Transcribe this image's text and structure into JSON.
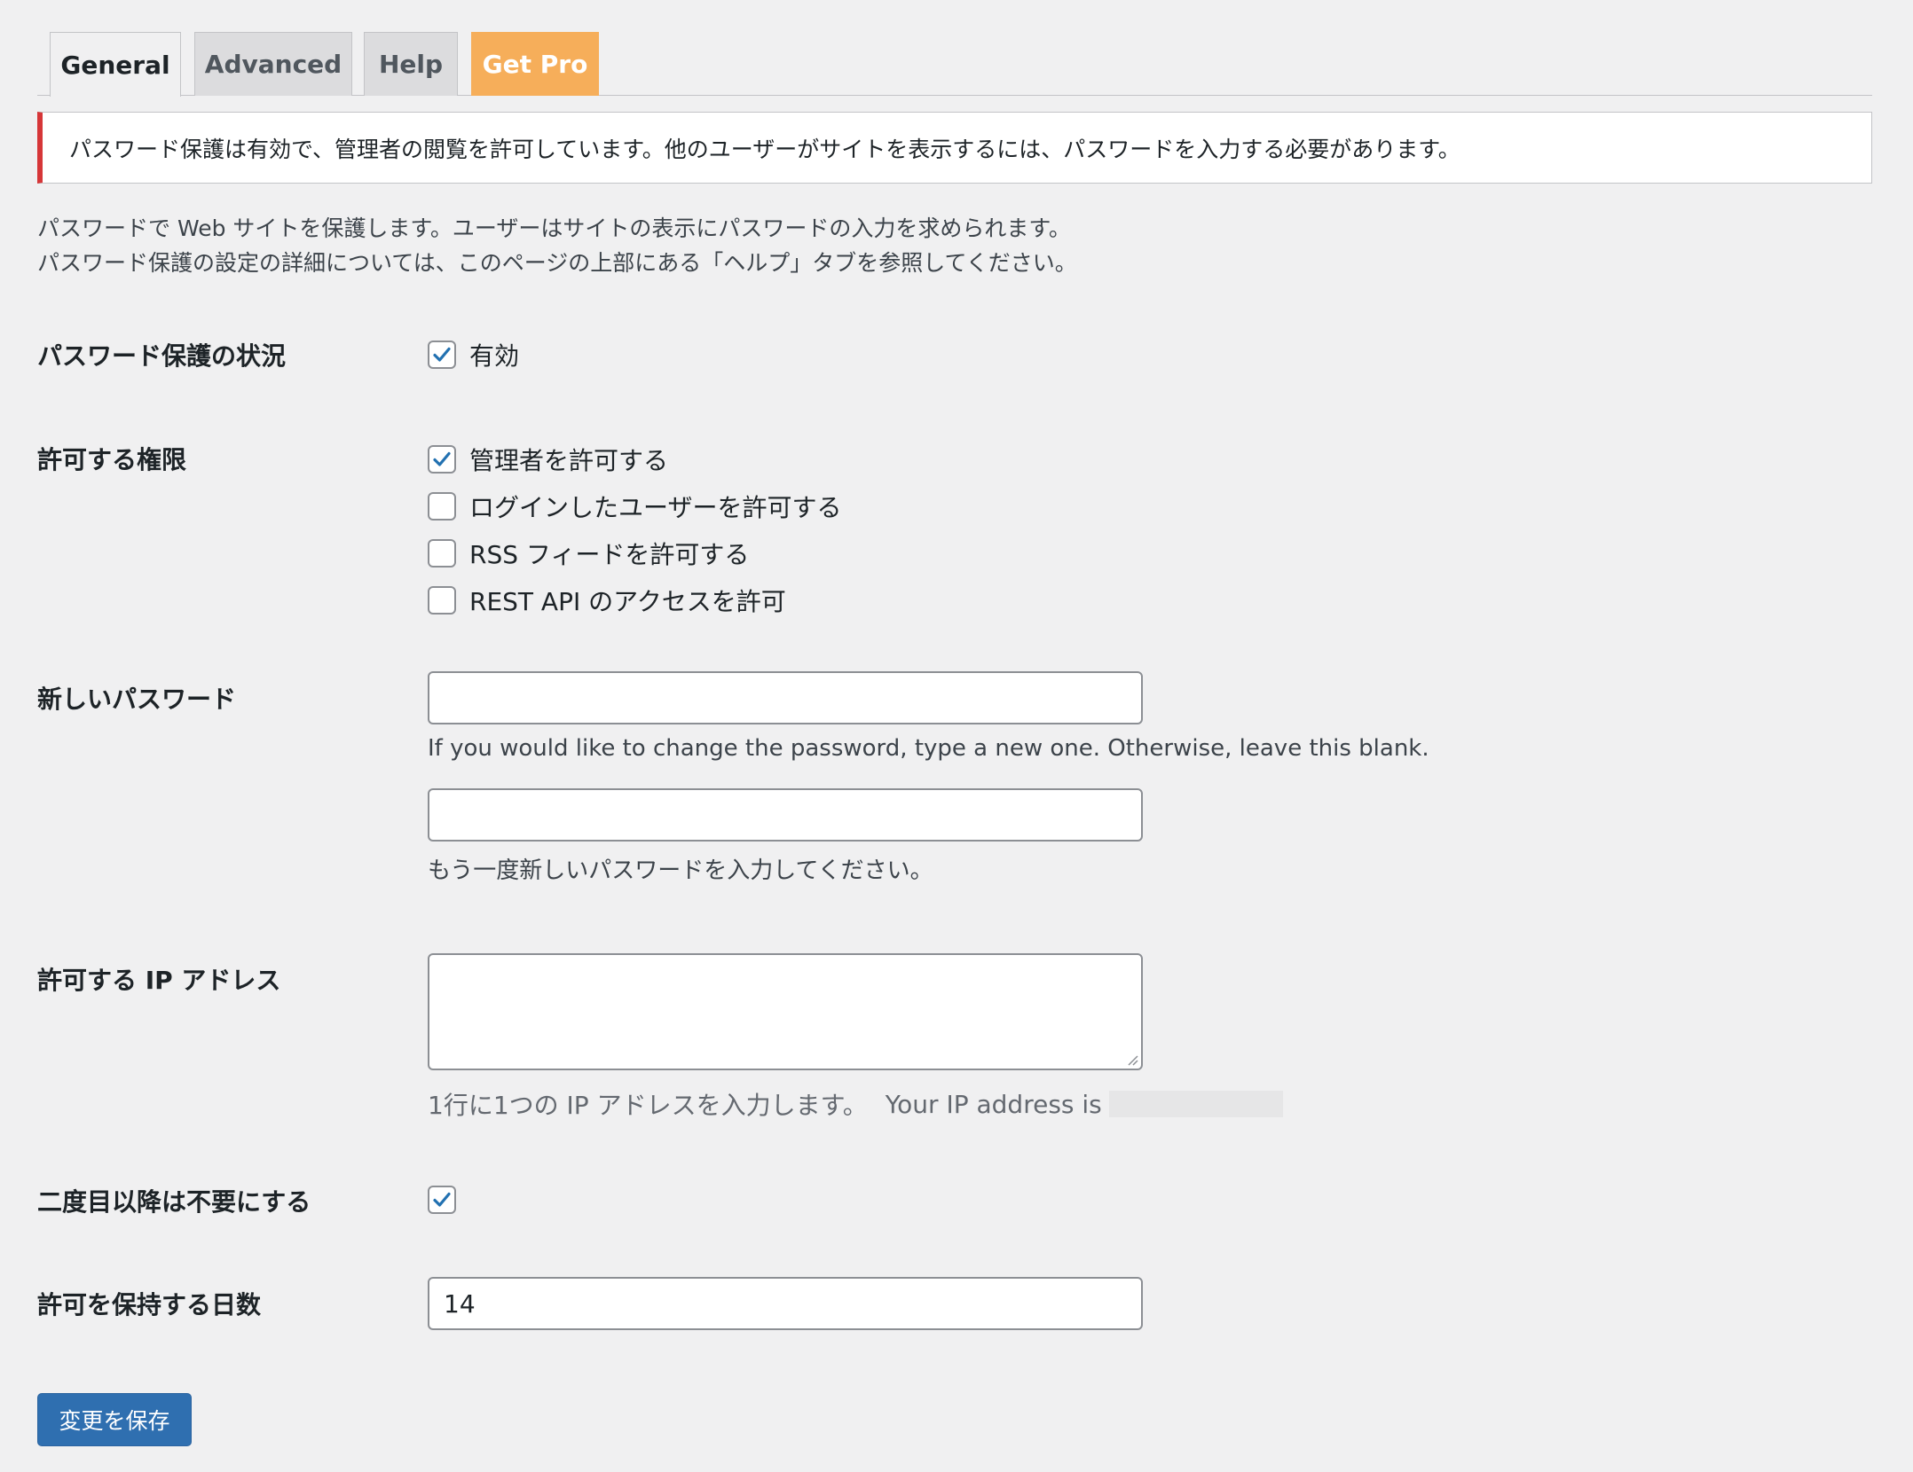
{
  "tabs": [
    {
      "label": "General",
      "active": true
    },
    {
      "label": "Advanced",
      "active": false
    },
    {
      "label": "Help",
      "active": false
    },
    {
      "label": "Get Pro",
      "active": false
    }
  ],
  "notice": {
    "text": "パスワード保護は有効で、管理者の閲覧を許可しています。他のユーザーがサイトを表示するには、パスワードを入力する必要があります。",
    "accent_color": "#d63638"
  },
  "intro": {
    "line1": "パスワードで Web サイトを保護します。ユーザーはサイトの表示にパスワードの入力を求められます。",
    "line2": "パスワード保護の設定の詳細については、このページの上部にある「ヘルプ」タブを参照してください。"
  },
  "status": {
    "label": "パスワード保護の状況",
    "checkbox_label": "有効",
    "checked": true
  },
  "permissions": {
    "label": "許可する権限",
    "options": [
      {
        "label": "管理者を許可する",
        "checked": true
      },
      {
        "label": "ログインしたユーザーを許可する",
        "checked": false
      },
      {
        "label": "RSS フィードを許可する",
        "checked": false
      },
      {
        "label": "REST API のアクセスを許可",
        "checked": false
      }
    ]
  },
  "new_password": {
    "label": "新しいパスワード",
    "value": "",
    "description": "If you would like to change the password, type a new one. Otherwise, leave this blank.",
    "confirm_value": "",
    "confirm_description": "もう一度新しいパスワードを入力してください。"
  },
  "allowed_ip": {
    "label": "許可する IP アドレス",
    "value": "",
    "description": "1行に1つの IP アドレスを入力します。",
    "your_ip_text": "Your IP address is"
  },
  "remember": {
    "label": "二度目以降は不要にする",
    "checked": true
  },
  "remember_days": {
    "label": "許可を保持する日数",
    "value": "14"
  },
  "save_button": {
    "label": "変更を保存",
    "color": "#2f6fb0"
  },
  "colors": {
    "background": "#f0f0f1",
    "pro_tab": "#f6ae5a",
    "check": "#2271b1"
  }
}
